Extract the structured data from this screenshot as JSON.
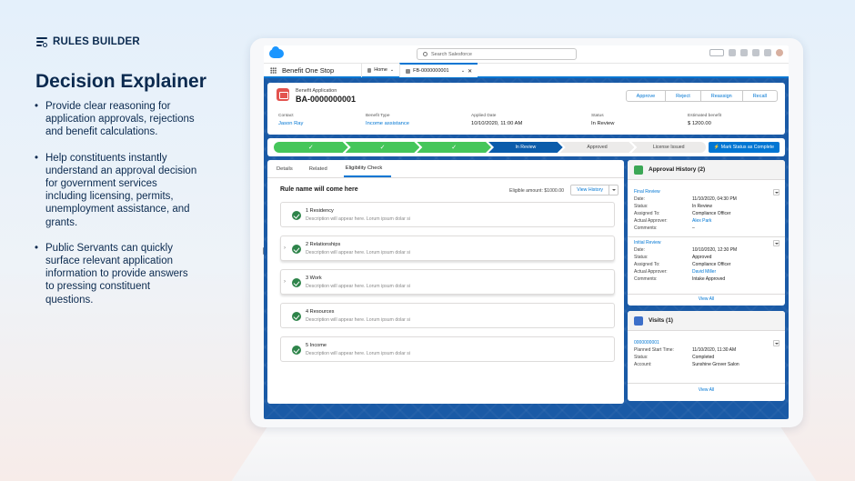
{
  "brand": {
    "name": "RULES BUILDER"
  },
  "headline": "Decision Explainer",
  "bullets": [
    "Provide clear reasoning for application approvals, rejections and benefit calculations.",
    "Help constituents instantly understand an approval decision for government services including licensing, permits, unemployment assistance, and grants.",
    "Public Servants can quickly surface relevant application information to provide answers to pressing constituent questions."
  ],
  "app": {
    "search_placeholder": "Search Salesforce",
    "app_name": "Benefit One Stop",
    "tabs": [
      {
        "label": "Home"
      },
      {
        "label": "FB-0000000001"
      }
    ]
  },
  "record": {
    "object_label": "Benefit Application",
    "name": "BA-0000000001",
    "actions": [
      "Approve",
      "Reject",
      "Reassign",
      "Recall"
    ],
    "fields": [
      {
        "label": "Contact",
        "value": "Jason Ray"
      },
      {
        "label": "Benefit Type",
        "value": "Income assistance"
      },
      {
        "label": "Applied Date",
        "value": "10/10/2020, 11:00 AM"
      },
      {
        "label": "Status",
        "value": "In Review"
      },
      {
        "label": "Estimated benefit",
        "value": "$ 1200.00"
      }
    ]
  },
  "path": {
    "steps": [
      {
        "label": "✓",
        "state": "done"
      },
      {
        "label": "✓",
        "state": "done"
      },
      {
        "label": "✓",
        "state": "done"
      },
      {
        "label": "In Review",
        "state": "current"
      },
      {
        "label": "Approved",
        "state": "todo"
      },
      {
        "label": "License Issued",
        "state": "todo"
      }
    ],
    "mark_button": "Mark Status as Complete"
  },
  "main": {
    "tabs": [
      "Details",
      "Related",
      "Eligibility Check"
    ],
    "active_tab": "Eligibility Check",
    "rule_heading": "Rule name will come here",
    "eligible_amount": "Eligible amount: $1000.00",
    "view_history": "View History",
    "rules": [
      {
        "title": "1 Residency",
        "desc": "Description will appear here. Lorum ipsum dolar si",
        "expandable": false
      },
      {
        "title": "2 Relationships",
        "desc": "Description will appear here. Lorum ipsum dolar si",
        "expandable": true
      },
      {
        "title": "3 Work",
        "desc": "Description will appear here. Lorum ipsum dolar si",
        "expandable": true
      },
      {
        "title": "4 Resources",
        "desc": "Description will appear here. Lorum ipsum dolar si",
        "expandable": false
      },
      {
        "title": "5 Income",
        "desc": "Description will appear here. Lorum ipsum dolar si",
        "expandable": false
      }
    ]
  },
  "approval_history": {
    "title": "Approval History (2)",
    "entries": [
      {
        "name": "Final Review",
        "rows": [
          {
            "k": "Date:",
            "v": "11/10/2020, 04:30 PM"
          },
          {
            "k": "Status:",
            "v": "In Review"
          },
          {
            "k": "Assigned To:",
            "v": "Compliance Officer"
          },
          {
            "k": "Actual Approver:",
            "v": "Alex Park",
            "link": true
          },
          {
            "k": "Comments:",
            "v": "–"
          }
        ]
      },
      {
        "name": "Initial Review",
        "rows": [
          {
            "k": "Date:",
            "v": "10/10/2020, 12:30 PM"
          },
          {
            "k": "Status:",
            "v": "Approved"
          },
          {
            "k": "Assigned To:",
            "v": "Compliance Officer"
          },
          {
            "k": "Actual Approver:",
            "v": "David Miller",
            "link": true
          },
          {
            "k": "Comments:",
            "v": "Intake Approved"
          }
        ]
      }
    ],
    "view_all": "View All"
  },
  "visits": {
    "title": "Visits (1)",
    "entry": {
      "name": "0000000001",
      "rows": [
        {
          "k": "Planned Start Time:",
          "v": "11/10/2020, 11:30 AM"
        },
        {
          "k": "Status:",
          "v": "Completed"
        },
        {
          "k": "Account:",
          "v": "Sunshine Grover Salon"
        }
      ]
    },
    "view_all": "View All"
  },
  "colors": {
    "navy": "#0b2a4f",
    "brand_blue": "#0176d3",
    "path_done": "#45c65a",
    "path_current": "#0b5cab",
    "check_green": "#2e844a",
    "record_icon": "#e3534f",
    "approval_icon": "#3ba755",
    "visits_icon": "#3c6fc9"
  },
  "icons": {
    "brand": "rules-builder-icon",
    "check": "success-check-icon",
    "approval": "approval-icon",
    "visits": "visits-icon"
  }
}
